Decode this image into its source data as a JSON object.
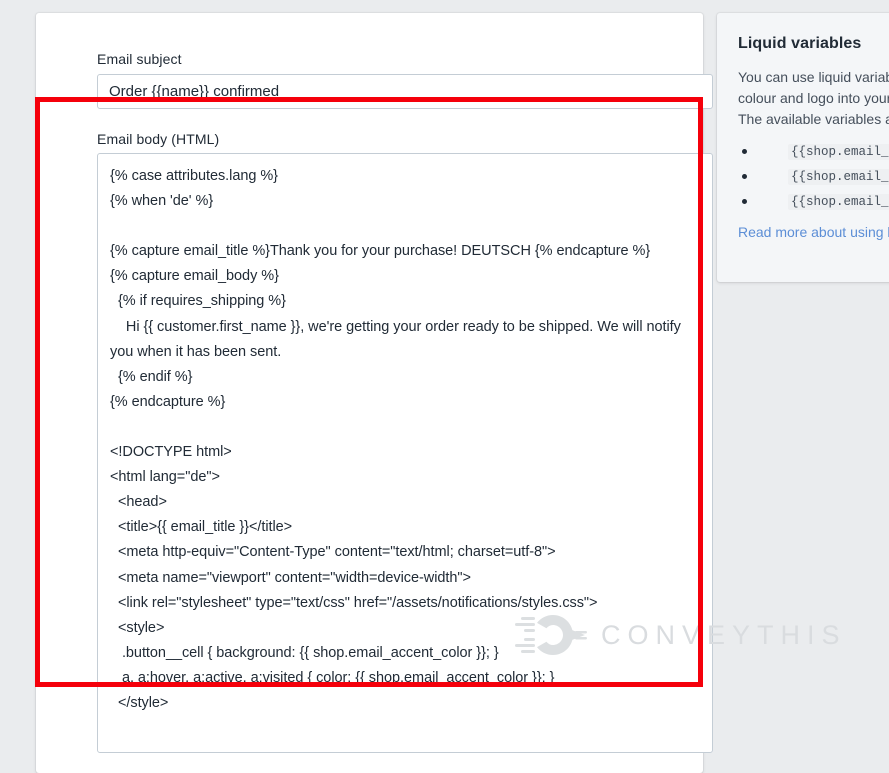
{
  "form": {
    "subject_label": "Email subject",
    "subject_value": "Order {{name}} confirmed",
    "subject_placeholder": "Email subject",
    "body_label": "Email body (HTML)",
    "body_value": "{% case attributes.lang %}\n{% when 'de' %}\n\n{% capture email_title %}Thank you for your purchase! DEUTSCH {% endcapture %}\n{% capture email_body %}\n  {% if requires_shipping %}\n    Hi {{ customer.first_name }}, we're getting your order ready to be shipped. We will notify you when it has been sent.\n  {% endif %}\n{% endcapture %}\n\n<!DOCTYPE html>\n<html lang=\"de\">\n  <head>\n  <title>{{ email_title }}</title>\n  <meta http-equiv=\"Content-Type\" content=\"text/html; charset=utf-8\">\n  <meta name=\"viewport\" content=\"width=device-width\">\n  <link rel=\"stylesheet\" type=\"text/css\" href=\"/assets/notifications/styles.css\">\n  <style>\n   .button__cell { background: {{ shop.email_accent_color }}; }\n   a, a:hover, a:active, a:visited { color: {{ shop.email_accent_color }}; }\n  </style>",
    "body_placeholder": "Email body (HTML)"
  },
  "sidebar": {
    "title": "Liquid variables",
    "paragraph": "You can use liquid variables to insert your accent colour and logo into your custom email templates. The available variables are:",
    "variables": [
      "{{shop.email_logo_url}}",
      "{{shop.email_logo_width}}",
      "{{shop.email_accent_color}}"
    ],
    "link_text": "Read more about using liquid in email templates"
  },
  "annotation": {
    "highlight_color": "#f5000b"
  },
  "watermark": {
    "text": "CONVEYTHIS",
    "color": "#d9dcdf"
  }
}
